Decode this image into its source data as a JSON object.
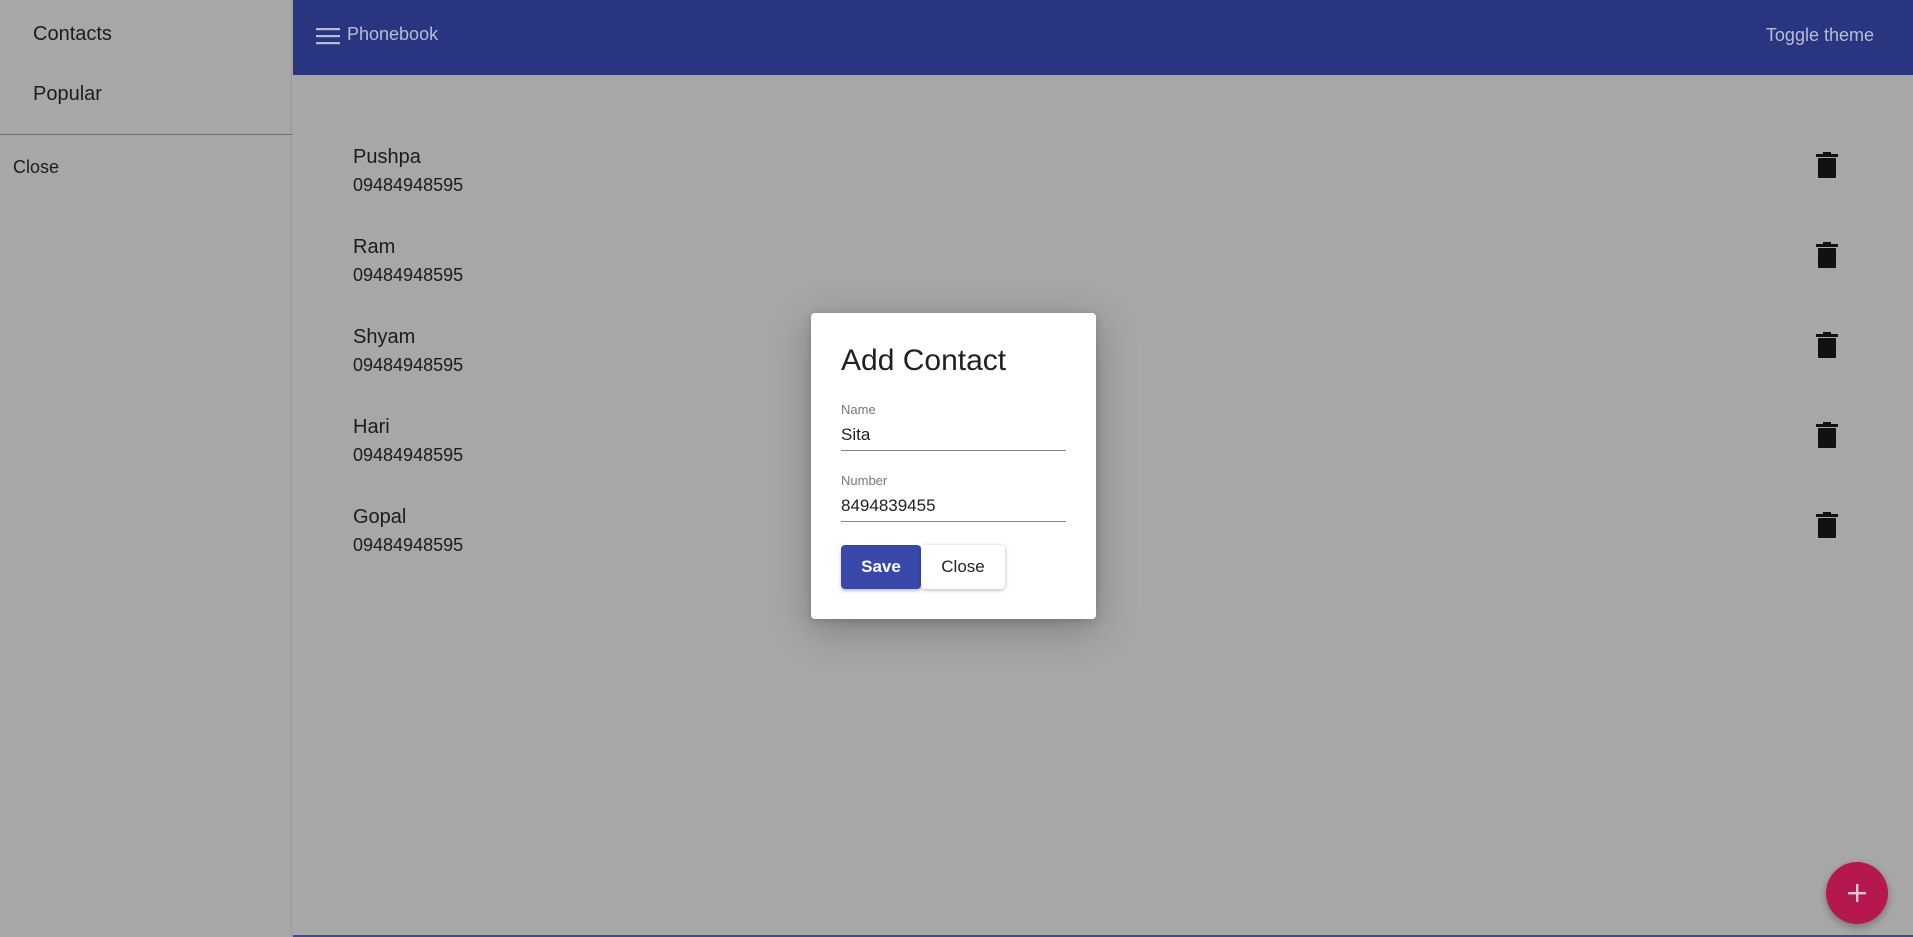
{
  "sidebar": {
    "items": [
      {
        "label": "Contacts",
        "icon": ""
      },
      {
        "label": "Popular",
        "icon": ""
      }
    ],
    "close_label": "Close"
  },
  "header": {
    "menu_icon": "hamburger-menu-icon",
    "title": "Phonebook",
    "toggle_theme_label": "Toggle theme",
    "bg_color": "#293580"
  },
  "contacts": [
    {
      "name": "Pushpa",
      "number": "09484948595"
    },
    {
      "name": "Ram",
      "number": "09484948595"
    },
    {
      "name": "Shyam",
      "number": "09484948595"
    },
    {
      "name": "Hari",
      "number": "09484948595"
    },
    {
      "name": "Gopal",
      "number": "09484948595"
    }
  ],
  "dialog": {
    "title": "Add Contact",
    "name_label": "Name",
    "name_value": "Sita",
    "number_label": "Number",
    "number_value": "8494839455",
    "save_label": "Save",
    "close_label": "Close",
    "save_color": "#3949ab"
  },
  "fab": {
    "icon": "plus-icon",
    "color": "#b5174f"
  }
}
